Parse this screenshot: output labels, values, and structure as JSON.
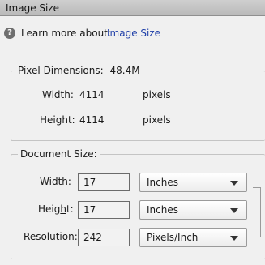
{
  "title": "Image Size",
  "help": {
    "icon": "help-icon",
    "text": "Learn more about:",
    "link": "Image Size"
  },
  "pixel_dimensions": {
    "label": "Pixel Dimensions:",
    "value": "48.4M",
    "width_label": "Width:",
    "width_value": "4114",
    "width_unit": "pixels",
    "height_label": "Height:",
    "height_value": "4114",
    "height_unit": "pixels"
  },
  "document_size": {
    "label": "Document Size:",
    "width": {
      "label_pre": "Wi",
      "label_u": "d",
      "label_post": "th:",
      "value": "17",
      "unit": "Inches"
    },
    "height": {
      "label_pre": "Heig",
      "label_u": "h",
      "label_post": "t:",
      "value": "17",
      "unit": "Inches"
    },
    "resolution": {
      "label_pre": "",
      "label_u": "R",
      "label_post": "esolution:",
      "value": "242",
      "unit": "Pixels/Inch"
    }
  }
}
